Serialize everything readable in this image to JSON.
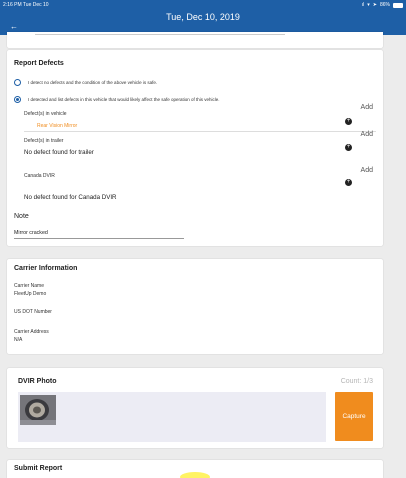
{
  "status_bar": {
    "time_date": "2:16 PM  Tue Dec 10",
    "signal": "ıl",
    "battery_text": "86%"
  },
  "nav": {
    "title": "Tue, Dec 10, 2019",
    "back_icon": "←"
  },
  "report_defects": {
    "title": "Report Defects",
    "option_no_defects": "I detect no defects and the condition of the above vehicle is safe.",
    "option_defects": "I detected and list defects in this vehicle that would likely affect the safe operation of this vehicle.",
    "vehicle": {
      "label": "Defect(s) in vehicle",
      "item": "Rear Vision Mirror",
      "add_label": "Add"
    },
    "trailer": {
      "label": "Defect(s) in trailer",
      "empty": "No defect found for trailer",
      "add_label": "Add"
    },
    "canada": {
      "label": "Canada DVIR",
      "empty": "No defect found for Canada DVIR",
      "add_label": "Add"
    },
    "note": {
      "label": "Note",
      "value": "Mirror cracked"
    }
  },
  "carrier": {
    "title": "Carrier Information",
    "name_label": "Carrier Name",
    "name_value": "FleetUp Demo",
    "dot_label": "US DOT Number",
    "address_label": "Carrier Address",
    "address_value": "N/A"
  },
  "photo": {
    "title": "DVIR Photo",
    "count": "Count: 1/3",
    "capture_label": "Capture"
  },
  "submit": {
    "title": "Submit Report"
  },
  "colors": {
    "primary": "#1e5fa6",
    "accent": "#f08c1e",
    "background": "#ececec"
  }
}
